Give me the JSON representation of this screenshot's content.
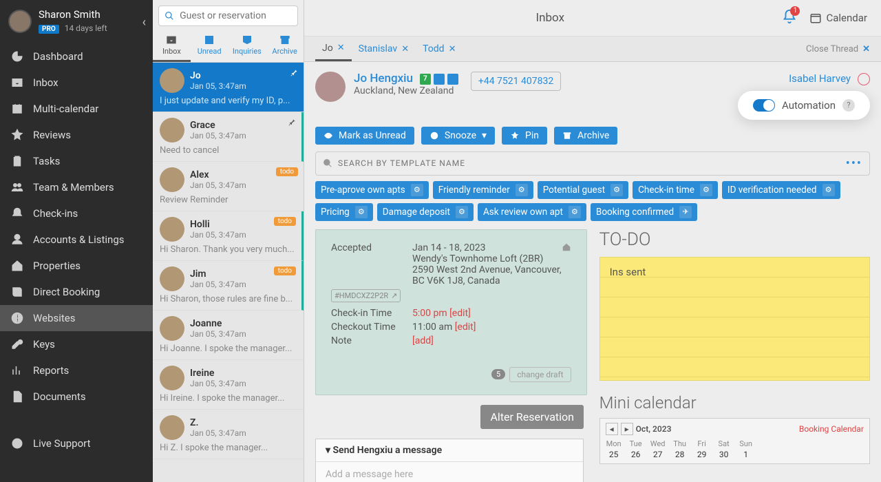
{
  "profile": {
    "name": "Sharon Smith",
    "badge": "PRO",
    "days_left": "14 days left"
  },
  "sidebar": {
    "items": [
      {
        "label": "Dashboard",
        "icon": "gauge-icon"
      },
      {
        "label": "Inbox",
        "icon": "inbox-icon"
      },
      {
        "label": "Multi-calendar",
        "icon": "calendar-icon"
      },
      {
        "label": "Reviews",
        "icon": "star-icon"
      },
      {
        "label": "Tasks",
        "icon": "clipboard-icon"
      },
      {
        "label": "Team & Members",
        "icon": "team-icon"
      },
      {
        "label": "Check-ins",
        "icon": "bell-icon"
      },
      {
        "label": "Accounts & Listings",
        "icon": "account-icon"
      },
      {
        "label": "Properties",
        "icon": "house-icon"
      },
      {
        "label": "Direct Booking",
        "icon": "book-icon"
      },
      {
        "label": "Websites",
        "icon": "globe-icon",
        "selected": true
      },
      {
        "label": "Keys",
        "icon": "key-icon"
      },
      {
        "label": "Reports",
        "icon": "chart-icon"
      },
      {
        "label": "Documents",
        "icon": "document-icon"
      }
    ],
    "live_support": "Live Support"
  },
  "inbox": {
    "search_placeholder": "Guest or reservation",
    "tabs": [
      {
        "label": "Inbox",
        "active": true
      },
      {
        "label": "Unread"
      },
      {
        "label": "Inquiries"
      },
      {
        "label": "Archive"
      }
    ],
    "threads": [
      {
        "name": "Jo",
        "time": "Jan 05, 3:47am",
        "preview": "I just update and verify my ID, p...",
        "selected": true,
        "pin": true
      },
      {
        "name": "Grace",
        "time": "Jan 05, 3:47am",
        "preview": "Need to cancel",
        "pin": true,
        "accent": true
      },
      {
        "name": "Alex",
        "time": "Jan 05, 3:47am",
        "preview": "Review Reminder",
        "tag": "todo"
      },
      {
        "name": "Holli",
        "time": "Jan 05, 3:47am",
        "preview": "Hi Sharon. Thank you very much...",
        "tag": "todo",
        "accent": true
      },
      {
        "name": "Jim",
        "time": "Jan 05, 3:47am",
        "preview": "Hi Sharon, those rules are fine b...",
        "tag": "todo",
        "accent": true
      },
      {
        "name": "Joanne",
        "time": "Jan 05, 3:47am",
        "preview": "Hi Joanne. I spoke the manager..."
      },
      {
        "name": "Ireine",
        "time": "Jan 05, 3:47am",
        "preview": "Hi Ireine. I spoke the manager..."
      },
      {
        "name": "Z.",
        "time": "Jan 05, 3:47am",
        "preview": "Hi Z. I spoke the manager..."
      }
    ]
  },
  "topbar": {
    "title": "Inbox",
    "notification_count": "1",
    "calendar_label": "Calendar"
  },
  "thread_tabs": {
    "tabs": [
      {
        "label": "Jo",
        "active": true
      },
      {
        "label": "Stanislav"
      },
      {
        "label": "Todd"
      }
    ],
    "close_label": "Close Thread"
  },
  "guest": {
    "name": "Jo Hengxiu",
    "rating": "7",
    "location": "Auckland, New Zealand",
    "phone": "+44 7521 407832",
    "owner": "Isabel Harvey",
    "automation_label": "Automation"
  },
  "actions": {
    "unread": "Mark as Unread",
    "snooze": "Snooze",
    "pin": "Pin",
    "archive": "Archive"
  },
  "templates": {
    "search_placeholder": "SEARCH BY TEMPLATE NAME",
    "chips": [
      "Pre-aprove own apts",
      "Friendly reminder",
      "Potential guest",
      "Check-in time",
      "ID verification needed",
      "Pricing",
      "Damage deposit",
      "Ask review own apt",
      "Booking confirmed"
    ]
  },
  "reservation": {
    "status": "Accepted",
    "dates": "Jan 14 - 18, 2023",
    "property": "Wendy's Townhome Loft (2BR)",
    "address1": "2590 West 2nd Avenue, Vancouver,",
    "address2": "BC V6K 1J8, Canada",
    "code": "#HMDCXZ2P2R",
    "checkin_label": "Check-in Time",
    "checkin_value": "5:00 pm",
    "checkout_label": "Checkout Time",
    "checkout_value": "11:00 am",
    "note_label": "Note",
    "edit": "[edit]",
    "add": "[add]",
    "change_draft": "change draft",
    "draft_count": "5",
    "alter": "Alter Reservation"
  },
  "todo": {
    "heading": "TO-DO",
    "note": "Ins sent"
  },
  "mini": {
    "heading": "Mini calendar",
    "month": "Oct, 2023",
    "booking_link": "Booking Calendar",
    "dow": [
      "Mon",
      "Tue",
      "Wed",
      "Thu",
      "Fri",
      "Sat",
      "Sun"
    ],
    "days": [
      "25",
      "26",
      "27",
      "28",
      "29",
      "30",
      "1"
    ]
  },
  "message": {
    "heading": "Send Hengxiu a message",
    "placeholder": "Add a message here"
  }
}
